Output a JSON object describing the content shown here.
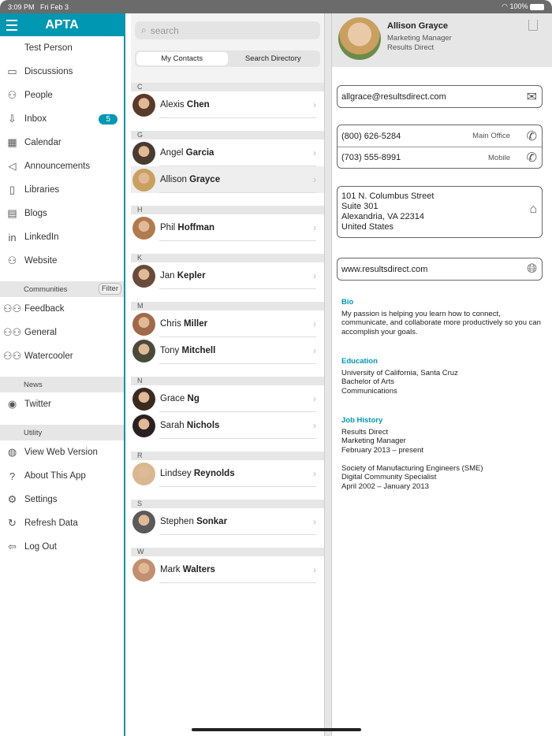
{
  "status": {
    "time": "3:09 PM",
    "date": "Fri Feb 3",
    "battery": "100%"
  },
  "sidebar": {
    "title": "APTA",
    "user": "Test Person",
    "items": [
      {
        "label": "Discussions",
        "icon": "chat-bubble-icon"
      },
      {
        "label": "People",
        "icon": "people-icon"
      },
      {
        "label": "Inbox",
        "icon": "inbox-icon",
        "badge": "5"
      },
      {
        "label": "Calendar",
        "icon": "calendar-icon"
      },
      {
        "label": "Announcements",
        "icon": "megaphone-icon"
      },
      {
        "label": "Libraries",
        "icon": "book-icon"
      },
      {
        "label": "Blogs",
        "icon": "blog-icon"
      },
      {
        "label": "LinkedIn",
        "icon": "linkedin-icon"
      },
      {
        "label": "Website",
        "icon": "person-icon"
      }
    ],
    "communities": {
      "header": "Communities",
      "filter": "Filter",
      "items": [
        "Feedback",
        "General",
        "Watercooler"
      ]
    },
    "news": {
      "header": "News",
      "items": [
        "Twitter"
      ]
    },
    "utility": {
      "header": "Utility",
      "items": [
        "View Web Version",
        "About This App",
        "Settings",
        "Refresh Data",
        "Log Out"
      ]
    }
  },
  "contacts": {
    "search_placeholder": "search",
    "tabs": [
      "My Contacts",
      "Search Directory"
    ],
    "sections": [
      {
        "letter": "C",
        "people": [
          {
            "first": "Alexis",
            "last": "Chen",
            "color": "#5a3a2a"
          }
        ]
      },
      {
        "letter": "G",
        "people": [
          {
            "first": "Angel",
            "last": "Garcia",
            "color": "#4a3a30"
          },
          {
            "first": "Allison",
            "last": "Grayce",
            "color": "#c9a060",
            "selected": true
          }
        ]
      },
      {
        "letter": "H",
        "people": [
          {
            "first": "Phil",
            "last": "Hoffman",
            "color": "#b07a50"
          }
        ]
      },
      {
        "letter": "K",
        "people": [
          {
            "first": "Jan",
            "last": "Kepler",
            "color": "#6a4a3a"
          }
        ]
      },
      {
        "letter": "M",
        "people": [
          {
            "first": "Chris",
            "last": "Miller",
            "color": "#a06a4a"
          },
          {
            "first": "Tony",
            "last": "Mitchell",
            "color": "#4a4a3a"
          }
        ]
      },
      {
        "letter": "N",
        "people": [
          {
            "first": "Grace",
            "last": "Ng",
            "color": "#3a2a20"
          },
          {
            "first": "Sarah",
            "last": "Nichols",
            "color": "#2a2020"
          }
        ]
      },
      {
        "letter": "R",
        "people": [
          {
            "first": "Lindsey",
            "last": "Reynolds",
            "color": "#d8b890"
          }
        ]
      },
      {
        "letter": "S",
        "people": [
          {
            "first": "Stephen",
            "last": "Sonkar",
            "color": "#5a5a5a"
          }
        ]
      },
      {
        "letter": "W",
        "people": [
          {
            "first": "Mark",
            "last": "Walters",
            "color": "#c09070"
          }
        ]
      }
    ]
  },
  "detail": {
    "name": "Allison Grayce",
    "title": "Marketing Manager",
    "company": "Results Direct",
    "email": "allgrace@resultsdirect.com",
    "phones": [
      {
        "number": "(800) 626-5284",
        "label": "Main Office"
      },
      {
        "number": "(703) 555-8991",
        "label": "Mobile"
      }
    ],
    "address": [
      "101 N. Columbus Street",
      "Suite 301",
      "Alexandria, VA 22314",
      "United States"
    ],
    "website": "www.resultsdirect.com",
    "bio": {
      "heading": "Bio",
      "text": "My passion is helping you learn how to connect, communicate, and collaborate more productively so you can accomplish your goals."
    },
    "education": {
      "heading": "Education",
      "lines": [
        "University of California, Santa Cruz",
        "Bachelor of Arts",
        "Communications"
      ]
    },
    "jobs": {
      "heading": "Job History",
      "lines": [
        "Results Direct",
        "Marketing Manager",
        "February 2013 – present",
        "",
        "Society of Manufacturing Engineers (SME)",
        "Digital Community Specialist",
        "April 2002 – January 2013"
      ]
    }
  }
}
